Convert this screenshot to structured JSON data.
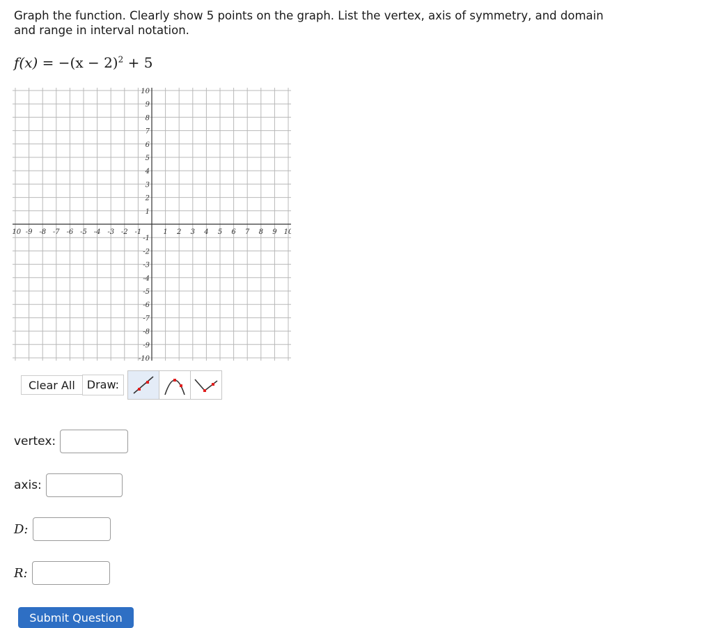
{
  "question": {
    "text": "Graph the function. Clearly show 5 points on the graph. List the vertex, axis of symmetry, and domain and range in interval notation."
  },
  "formula": {
    "lhs": "f(x)",
    "rhs_prefix": " = −(x − 2)",
    "exponent": "2",
    "rhs_suffix": " + 5"
  },
  "graph": {
    "x_min": -10,
    "x_max": 10,
    "y_min": -10,
    "y_max": 10,
    "x_ticks": [
      "-10",
      "-9",
      "-8",
      "-7",
      "-6",
      "-5",
      "-4",
      "-3",
      "-2",
      "-1",
      "1",
      "2",
      "3",
      "4",
      "5",
      "6",
      "7",
      "8",
      "9",
      "10"
    ],
    "y_ticks": [
      "10",
      "9",
      "8",
      "7",
      "6",
      "5",
      "4",
      "3",
      "2",
      "1",
      "-1",
      "-2",
      "-3",
      "-4",
      "-5",
      "-6",
      "-7",
      "-8",
      "-9",
      "-10"
    ],
    "grid_color": "#b8b8b8",
    "axis_color": "#333333"
  },
  "toolbar": {
    "clear_label": "Clear All",
    "draw_label": "Draw:",
    "tools": [
      {
        "icon": "line-tool-icon",
        "active": true
      },
      {
        "icon": "parabola-down-tool-icon",
        "active": false
      },
      {
        "icon": "absolute-value-tool-icon",
        "active": false
      }
    ],
    "accent_color": "#e02020"
  },
  "fields": {
    "vertex_label": "vertex:",
    "axis_label": "axis:",
    "domain_label": "D:",
    "range_label": "R:",
    "vertex_value": "",
    "axis_value": "",
    "domain_value": "",
    "range_value": ""
  },
  "submit_label": "Submit Question"
}
